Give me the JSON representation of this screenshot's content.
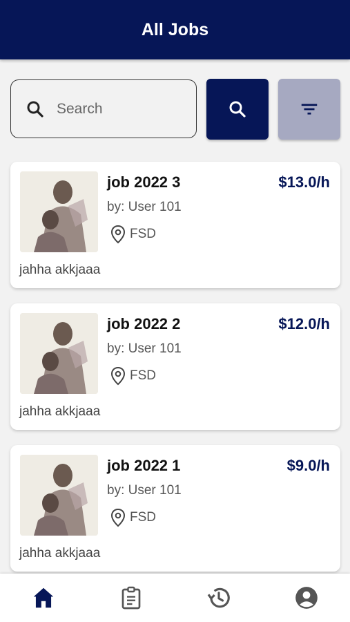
{
  "appbar": {
    "title": "All Jobs"
  },
  "search": {
    "placeholder": "Search"
  },
  "colors": {
    "primary": "#061657",
    "filter_bg": "#a6a9c1",
    "nav_active": "#061657",
    "nav_inactive": "#555555"
  },
  "jobs": [
    {
      "title": "job 2022 3",
      "by": "by: User 101",
      "location": "FSD",
      "rate": "$13.0/h",
      "description": "jahha akkjaaa"
    },
    {
      "title": "job 2022 2",
      "by": "by: User 101",
      "location": "FSD",
      "rate": "$12.0/h",
      "description": "jahha akkjaaa"
    },
    {
      "title": "job 2022 1",
      "by": "by: User 101",
      "location": "FSD",
      "rate": "$9.0/h",
      "description": "jahha akkjaaa"
    }
  ],
  "bottom_nav": [
    {
      "icon": "home-icon",
      "active": true
    },
    {
      "icon": "clipboard-icon",
      "active": false
    },
    {
      "icon": "history-icon",
      "active": false
    },
    {
      "icon": "account-icon",
      "active": false
    }
  ]
}
